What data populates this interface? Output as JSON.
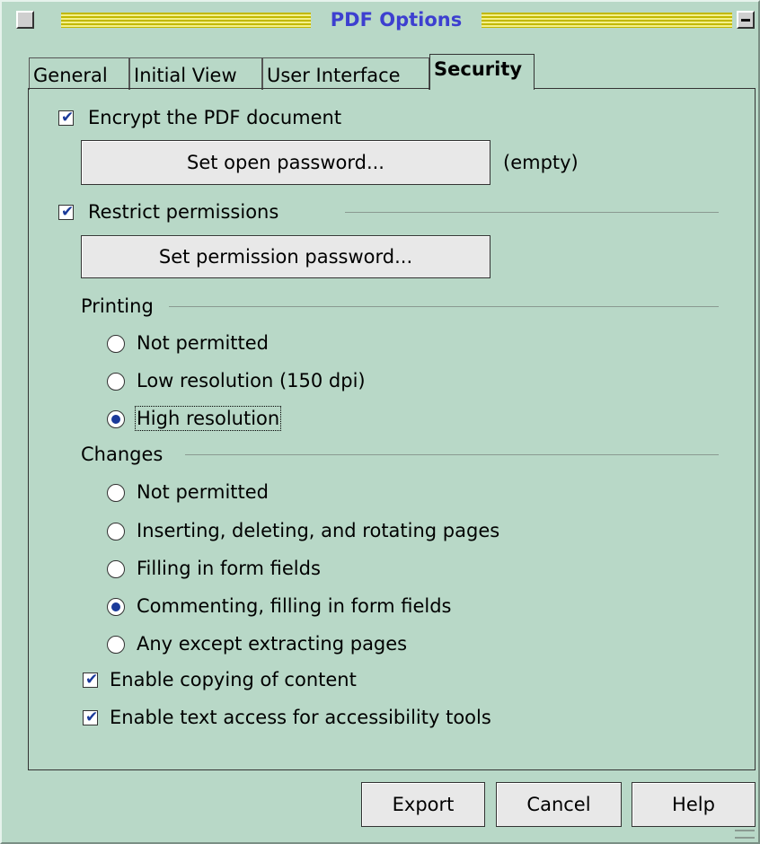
{
  "window": {
    "title": "PDF Options"
  },
  "tabs": [
    {
      "label": "General"
    },
    {
      "label": "Initial View"
    },
    {
      "label": "User Interface"
    },
    {
      "label": "Security"
    }
  ],
  "security": {
    "encrypt": {
      "label": "Encrypt the PDF document",
      "checked": true
    },
    "open_password_button": "Set open password...",
    "open_password_status": "(empty)",
    "restrict": {
      "label": "Restrict permissions",
      "checked": true
    },
    "permission_password_button": "Set permission password...",
    "printing": {
      "heading": "Printing",
      "options": [
        "Not permitted",
        "Low resolution (150 dpi)",
        "High resolution"
      ],
      "selected": "High resolution"
    },
    "changes": {
      "heading": "Changes",
      "options": [
        "Not permitted",
        "Inserting, deleting, and rotating pages",
        "Filling in form fields",
        "Commenting, filling in form fields",
        "Any except extracting pages"
      ],
      "selected": "Commenting, filling in form fields"
    },
    "copy_content": {
      "label": "Enable copying of content",
      "checked": true
    },
    "accessibility": {
      "label": "Enable text access for accessibility tools",
      "checked": true
    }
  },
  "buttons": {
    "export": "Export",
    "cancel": "Cancel",
    "help": "Help"
  }
}
